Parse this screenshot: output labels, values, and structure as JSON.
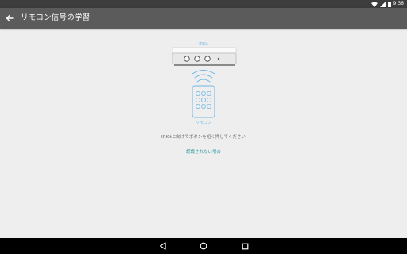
{
  "status_bar": {
    "time": "9:36",
    "icons": [
      "wifi-icon",
      "signal-icon",
      "battery-icon"
    ]
  },
  "app_bar": {
    "title": "リモコン信号の学習",
    "back_icon": "arrow-back-icon"
  },
  "illustration": {
    "device_label": "IRKit",
    "remote_label": "リモコン"
  },
  "instruction": "IRKitに向けてボタンを短く押してください",
  "help_link": "認識されない場合",
  "nav_bar": {
    "icons": [
      "back-triangle-icon",
      "home-circle-icon",
      "recents-square-icon"
    ]
  },
  "colors": {
    "accent": "#2e9aa0",
    "illustration_blue": "#6fb8e8",
    "app_bar": "#5b5b5b",
    "background": "#eeeeee"
  }
}
